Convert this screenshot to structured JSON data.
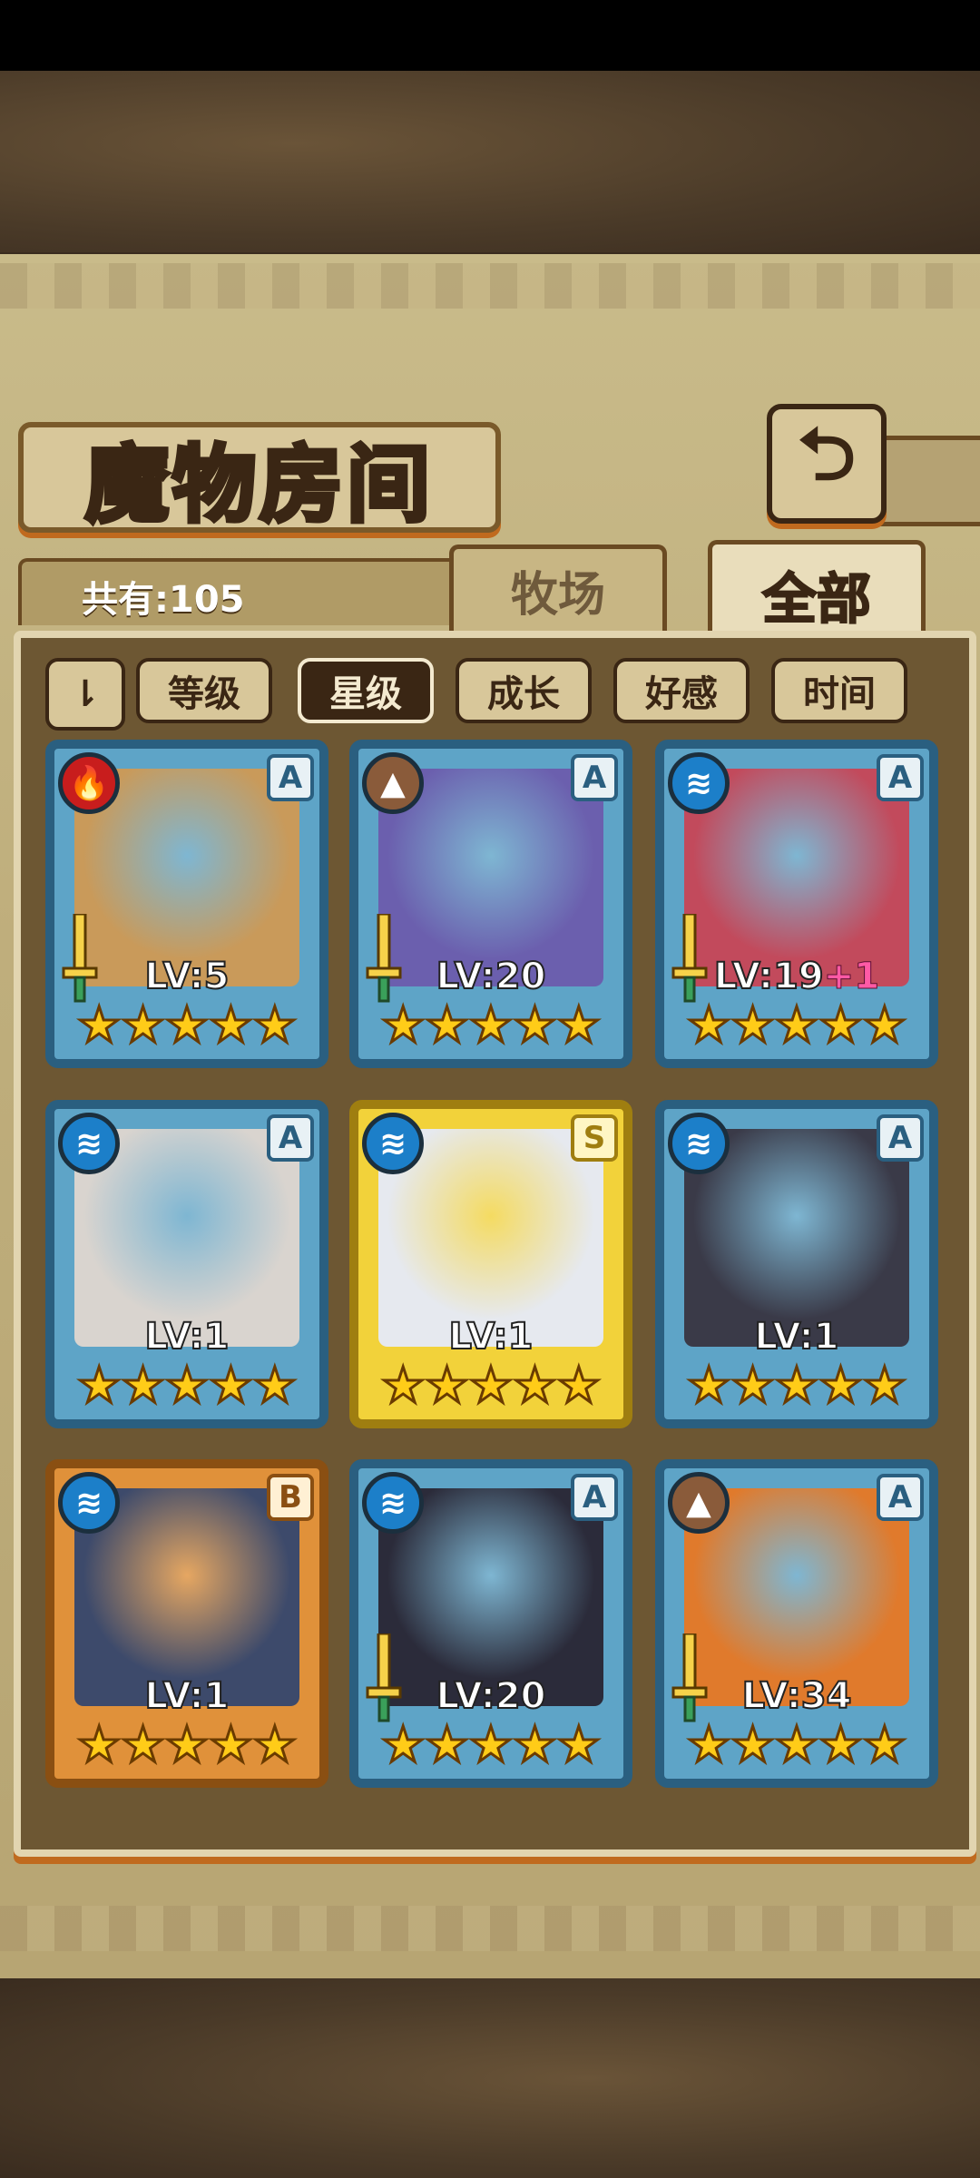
{
  "header": {
    "title": "魔物房间"
  },
  "summary": {
    "count_label": "共有:105"
  },
  "tabs": [
    {
      "label": "牧场",
      "active": false
    },
    {
      "label": "全部",
      "active": true
    }
  ],
  "filters": {
    "toggle_icon": "sort-order-icon",
    "toggle_label": "⇂",
    "items": [
      {
        "label": "等级",
        "active": false
      },
      {
        "label": "星级",
        "active": true
      },
      {
        "label": "成长",
        "active": false
      },
      {
        "label": "好感",
        "active": false
      },
      {
        "label": "时间",
        "active": false
      }
    ]
  },
  "monsters": [
    {
      "element": "fire",
      "element_glyph": "🔥",
      "rank": "A",
      "level": "LV:5",
      "plus": "",
      "stars": "★★★★★",
      "equipped": true,
      "portrait_color": "#c99a5a"
    },
    {
      "element": "earth",
      "element_glyph": "▲",
      "rank": "A",
      "level": "LV:20",
      "plus": "",
      "stars": "★★★★★",
      "equipped": true,
      "portrait_color": "#6b5fae"
    },
    {
      "element": "water",
      "element_glyph": "≋",
      "rank": "A",
      "level": "LV:19",
      "plus": "+1",
      "stars": "★★★★★",
      "equipped": true,
      "portrait_color": "#c24a5c"
    },
    {
      "element": "water",
      "element_glyph": "≋",
      "rank": "A",
      "level": "LV:1",
      "plus": "",
      "stars": "★★★★★",
      "equipped": false,
      "portrait_color": "#d9d4cf"
    },
    {
      "element": "water",
      "element_glyph": "≋",
      "rank": "S",
      "level": "LV:1",
      "plus": "",
      "stars": "★★★★★",
      "equipped": false,
      "portrait_color": "#e6e9ef"
    },
    {
      "element": "water",
      "element_glyph": "≋",
      "rank": "A",
      "level": "LV:1",
      "plus": "",
      "stars": "★★★★★",
      "equipped": false,
      "portrait_color": "#3a3a48"
    },
    {
      "element": "water",
      "element_glyph": "≋",
      "rank": "B",
      "level": "LV:1",
      "plus": "",
      "stars": "★★★★★",
      "equipped": false,
      "portrait_color": "#3d4a6b"
    },
    {
      "element": "water",
      "element_glyph": "≋",
      "rank": "A",
      "level": "LV:20",
      "plus": "",
      "stars": "★★★★★",
      "equipped": true,
      "portrait_color": "#2b2b3a"
    },
    {
      "element": "earth",
      "element_glyph": "▲",
      "rank": "A",
      "level": "LV:34",
      "plus": "",
      "stars": "★★★★★",
      "equipped": true,
      "portrait_color": "#e07a2c"
    }
  ],
  "colors": {
    "accent": "#c06a1e",
    "panel": "#6d5733",
    "star": "#ffcc18"
  }
}
